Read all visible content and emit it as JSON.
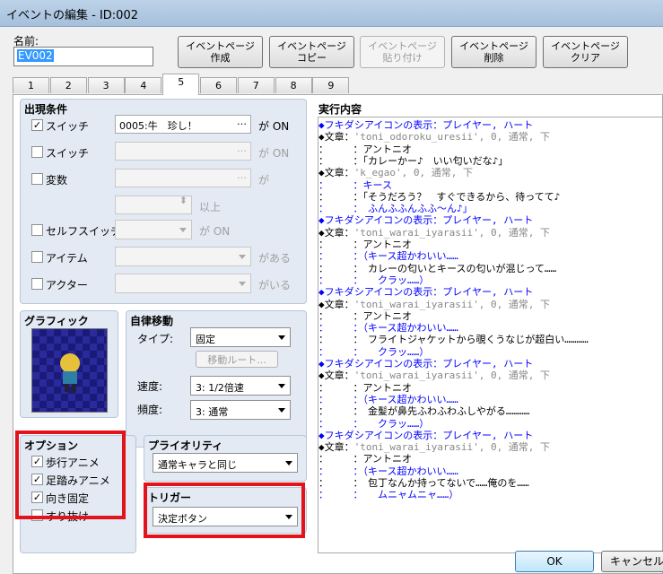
{
  "window": {
    "title": "イベントの編集 - ID:002"
  },
  "name": {
    "label": "名前:",
    "value": "EV002"
  },
  "toolbar": [
    {
      "label": "イベントページ\n作成",
      "enabled": true
    },
    {
      "label": "イベントページ\nコピー",
      "enabled": true
    },
    {
      "label": "イベントページ\n貼り付け",
      "enabled": false
    },
    {
      "label": "イベントページ\n削除",
      "enabled": true
    },
    {
      "label": "イベントページ\nクリア",
      "enabled": true
    }
  ],
  "tabs": [
    "1",
    "2",
    "3",
    "4",
    "5",
    "6",
    "7",
    "8",
    "9"
  ],
  "active_tab": "5",
  "conditions": {
    "title": "出現条件",
    "switch1": {
      "label": "スイッチ",
      "value": "0005:牛　珍し！",
      "suffix": "が ON",
      "checked": true
    },
    "switch2": {
      "label": "スイッチ",
      "value": "",
      "suffix": "が ON",
      "checked": false
    },
    "variable": {
      "label": "変数",
      "value": "",
      "suffix": "が",
      "checked": false
    },
    "variable_num_suffix": "以上",
    "selfswitch": {
      "label": "セルフスイッチ",
      "suffix": "が ON",
      "checked": false
    },
    "item": {
      "label": "アイテム",
      "suffix": "がある",
      "checked": false
    },
    "actor": {
      "label": "アクター",
      "suffix": "がいる",
      "checked": false
    }
  },
  "graphic": {
    "title": "グラフィック"
  },
  "autonomous": {
    "title": "自律移動",
    "type_label": "タイプ:",
    "type_value": "固定",
    "route_button": "移動ルート...",
    "speed_label": "速度:",
    "speed_value": "3: 1/2倍速",
    "freq_label": "頻度:",
    "freq_value": "3: 通常"
  },
  "options": {
    "title": "オプション",
    "items": [
      {
        "label": "歩行アニメ",
        "checked": true
      },
      {
        "label": "足踏みアニメ",
        "checked": true
      },
      {
        "label": "向き固定",
        "checked": true
      },
      {
        "label": "すり抜け",
        "checked": false
      }
    ]
  },
  "priority": {
    "title": "プライオリティ",
    "value": "通常キャラと同じ"
  },
  "trigger": {
    "title": "トリガー",
    "value": "決定ボタン"
  },
  "script": {
    "title": "実行内容",
    "lines": [
      {
        "t": "◆フキダシアイコンの表示：プレイヤー, ハート",
        "c": "c-blue"
      },
      {
        "t": "◆文章：",
        "c": "",
        "g": "'toni_odoroku_uresii', 0, 通常, 下"
      },
      {
        "t": "：　　　：アントニオ",
        "c": ""
      },
      {
        "t": "：　　　：「カレーかー♪　いい匂いだな♪」",
        "c": ""
      },
      {
        "t": "◆文章：",
        "c": "",
        "g": "'k_egao', 0, 通常, 下"
      },
      {
        "t": "：　　　：キース",
        "c": "c-blue"
      },
      {
        "t": "：　　　：「そうだろう？　すぐできるから、待ってて♪",
        "c": ""
      },
      {
        "t": "：　　　：　ふんふふんふふ～ん♪」",
        "c": "c-blue"
      },
      {
        "t": "◆フキダシアイコンの表示：プレイヤー, ハート",
        "c": "c-blue"
      },
      {
        "t": "◆文章：",
        "c": "",
        "g": "'toni_warai_iyarasii', 0, 通常, 下"
      },
      {
        "t": "：　　　：アントニオ",
        "c": ""
      },
      {
        "t": "：　　　：（キース超かわいい……",
        "c": "c-blue"
      },
      {
        "t": "：　　　：　カレーの匂いとキースの匂いが混じって……",
        "c": ""
      },
      {
        "t": "：　　　：　　クラッ……）",
        "c": "c-blue"
      },
      {
        "t": "◆フキダシアイコンの表示：プレイヤー, ハート",
        "c": "c-blue"
      },
      {
        "t": "◆文章：",
        "c": "",
        "g": "'toni_warai_iyarasii', 0, 通常, 下"
      },
      {
        "t": "：　　　：アントニオ",
        "c": ""
      },
      {
        "t": "：　　　：（キース超かわいい……",
        "c": "c-blue"
      },
      {
        "t": "：　　　：　フライトジャケットから覗くうなじが超白い…………",
        "c": ""
      },
      {
        "t": "：　　　：　　クラッ……）",
        "c": "c-blue"
      },
      {
        "t": "◆フキダシアイコンの表示：プレイヤー, ハート",
        "c": "c-blue"
      },
      {
        "t": "◆文章：",
        "c": "",
        "g": "'toni_warai_iyarasii', 0, 通常, 下"
      },
      {
        "t": "：　　　：アントニオ",
        "c": ""
      },
      {
        "t": "：　　　：（キース超かわいい……",
        "c": "c-blue"
      },
      {
        "t": "：　　　：　金髪が鼻先ふわふわふしやがる…………",
        "c": ""
      },
      {
        "t": "：　　　：　　クラッ……）",
        "c": "c-blue"
      },
      {
        "t": "◆フキダシアイコンの表示：プレイヤー, ハート",
        "c": "c-blue"
      },
      {
        "t": "◆文章：",
        "c": "",
        "g": "'toni_warai_iyarasii', 0, 通常, 下"
      },
      {
        "t": "：　　　：アントニオ",
        "c": ""
      },
      {
        "t": "：　　　：（キース超かわいい……",
        "c": "c-blue"
      },
      {
        "t": "：　　　：　包丁なんか持ってないで……俺のを……",
        "c": ""
      },
      {
        "t": "：　　　：　　ムニャムニャ……）",
        "c": "c-blue"
      }
    ]
  },
  "footer": {
    "ok": "OK",
    "cancel": "キャンセル"
  },
  "colors": {
    "highlight": "#e3131b",
    "selection": "#3399ff",
    "script_blue": "#0000ff"
  }
}
